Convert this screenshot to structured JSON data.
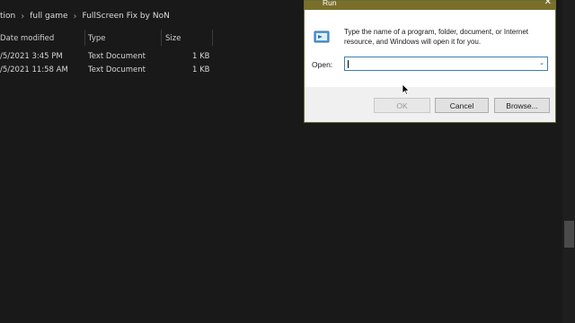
{
  "explorer": {
    "breadcrumb": [
      "tion",
      "full game",
      "FullScreen Fix by NoN"
    ],
    "columns": {
      "date": "Date modified",
      "type": "Type",
      "size": "Size"
    },
    "rows": [
      {
        "date": "/5/2021 3:45 PM",
        "type": "Text Document",
        "size": "1 KB"
      },
      {
        "date": "/5/2021 11:58 AM",
        "type": "Text Document",
        "size": "1 KB"
      }
    ]
  },
  "run_dialog": {
    "title": "Run",
    "close_glyph": "✕",
    "description": "Type the name of a program, folder, document, or Internet resource, and Windows will open it for you.",
    "open_label": "Open:",
    "open_value": "",
    "dropdown_glyph": "⌄",
    "buttons": {
      "ok": "OK",
      "cancel": "Cancel",
      "browse": "Browse..."
    }
  },
  "colors": {
    "titlebar": "#7a6f2a",
    "focus_border": "#3c7fb1",
    "explorer_bg": "#191919"
  },
  "icons": [
    "run-icon",
    "close-icon",
    "chevron-down-icon",
    "mouse-pointer-icon"
  ]
}
